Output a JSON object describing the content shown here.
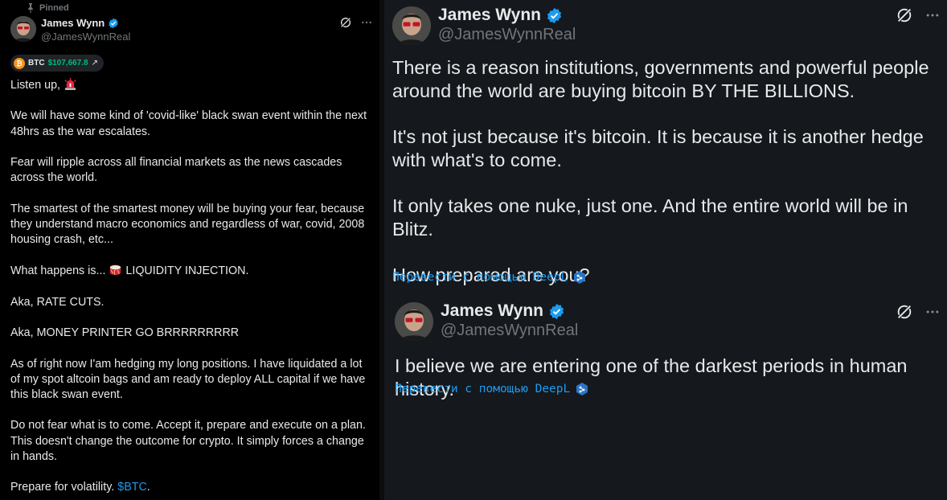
{
  "left_tweet": {
    "pinned_label": "Pinned",
    "author": {
      "name": "James Wynn",
      "handle": "@JamesWynnReal"
    },
    "ticker": {
      "symbol": "BTC",
      "price": "$107,667.8"
    },
    "paragraphs": [
      "Listen up,",
      "We will have some kind of 'covid-like' black swan event within the next 48hrs as the war escalates.",
      "Fear will ripple across all financial markets as the news cascades across the world.",
      "The smartest of the smartest money will be buying your fear, because they understand macro economics and regardless of war, covid, 2008 housing crash, etc...",
      "What happens is...",
      "Aka, RATE CUTS.",
      "Aka, MONEY PRINTER GO BRRRRRRRRR",
      "As of right now I'am hedging my long positions. I have liquidated a lot of my spot altcoin bags and am ready to deploy ALL capital if we have this black swan event.",
      "Do not fear what is to come. Accept it, prepare and execute on a plan. This doesn't change the outcome for crypto. It simply forces a change in hands.",
      "Prepare for volatility."
    ],
    "liquidity_text": "LIQUIDITY INJECTION.",
    "cashtag": "$BTC",
    "cashtag_suffix": "."
  },
  "right_tweet_1": {
    "author": {
      "name": "James Wynn",
      "handle": "@JamesWynnReal"
    },
    "paragraphs": [
      "There is a reason institutions, governments and powerful people around the world are buying bitcoin BY THE BILLIONS.",
      "It's not just because it's bitcoin. It is because it is another hedge with what's to come.",
      "It only takes one nuke, just one. And the entire world will be in Blitz.",
      "How prepared are you?"
    ],
    "translate_label": "Перевести с помощью DeepL"
  },
  "right_tweet_2": {
    "author": {
      "name": "James Wynn",
      "handle": "@JamesWynnReal"
    },
    "text": "I believe we are entering one of the darkest periods in human history.",
    "translate_label": "Перевести с помощью DeepL"
  },
  "colors": {
    "accent": "#1d9bf0",
    "price_green": "#00ba7c",
    "bitcoin_orange": "#f7931a",
    "muted": "#71767b"
  }
}
